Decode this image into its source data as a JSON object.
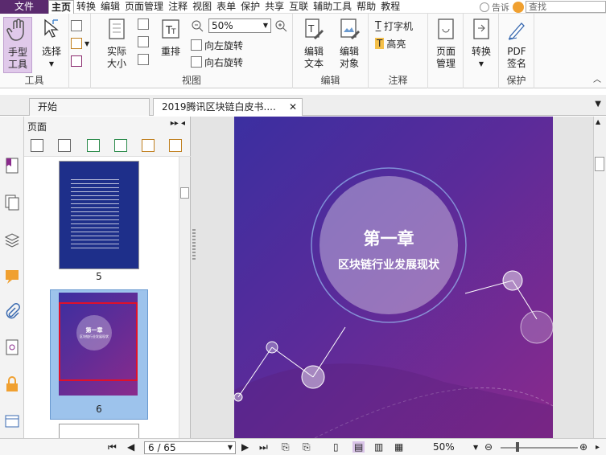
{
  "menubar": {
    "file": "文件",
    "items": [
      "主页",
      "转换",
      "编辑",
      "页面管理",
      "注释",
      "视图",
      "表单",
      "保护",
      "共享",
      "互联",
      "辅助工具",
      "帮助",
      "教程"
    ],
    "tell": "告诉",
    "search_placeholder": "查找"
  },
  "ribbon": {
    "tools": {
      "hand": "手型\n工具",
      "select": "选择",
      "group": "工具"
    },
    "view": {
      "actual": "实际\n大小",
      "reflow": "重排",
      "zoom": "50%",
      "rotate_left": "向左旋转",
      "rotate_right": "向右旋转",
      "group": "视图"
    },
    "edit": {
      "text": "编辑\n文本",
      "object": "编辑\n对象",
      "group": "编辑"
    },
    "comment": {
      "typewriter": "打字机",
      "highlight": "高亮",
      "group": "注释"
    },
    "page": {
      "manage": "页面\n管理"
    },
    "convert": {
      "label": "转换"
    },
    "protect": {
      "sign": "PDF\n签名",
      "group": "保护"
    }
  },
  "tabs": {
    "start": "开始",
    "doc": "2019腾讯区块链白皮书...."
  },
  "panel": {
    "title": "页面",
    "thumbs": [
      {
        "label": "5"
      },
      {
        "label": "6",
        "title": "第一章",
        "subtitle": "区块链行业发展现状"
      }
    ]
  },
  "page": {
    "title": "第一章",
    "subtitle": "区块链行业发展现状"
  },
  "status": {
    "page": "6 / 65",
    "zoom": "50%"
  },
  "colors": {
    "accent": "#5a2a6e",
    "page_gradient_start": "#3b2fa0",
    "page_gradient_end": "#8a2a8c"
  }
}
